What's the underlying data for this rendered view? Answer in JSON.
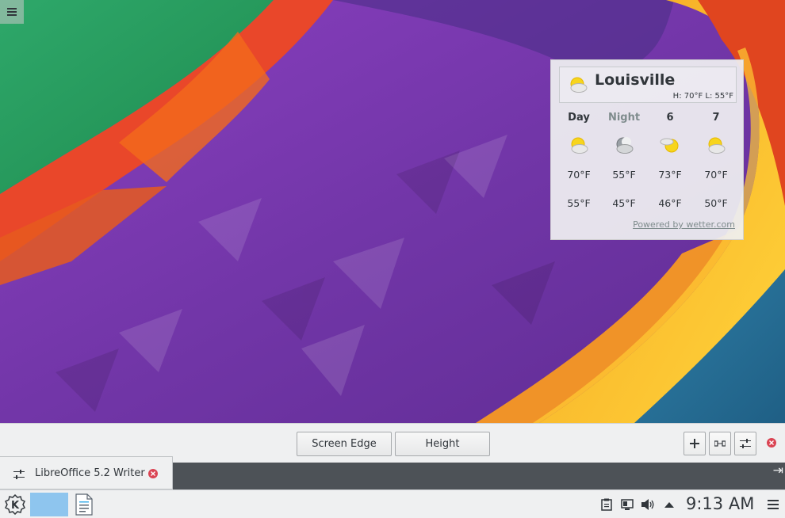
{
  "weather": {
    "city": "Louisville",
    "hilo": "H: 70°F L: 55°F",
    "current_icon": "partly-cloudy-day-icon",
    "forecast": [
      {
        "label": "Day",
        "icon": "partly-cloudy-day-icon",
        "high": "70°F",
        "low": "55°F"
      },
      {
        "label": "Night",
        "icon": "partly-cloudy-night-icon",
        "high": "55°F",
        "low": "45°F"
      },
      {
        "label": "6",
        "icon": "partly-sunny-icon",
        "high": "73°F",
        "low": "46°F"
      },
      {
        "label": "7",
        "icon": "partly-cloudy-day-icon",
        "high": "70°F",
        "low": "50°F"
      }
    ],
    "powered_by": "Powered by wetter.com"
  },
  "panel_toolbar": {
    "screen_edge_label": "Screen Edge",
    "height_label": "Height"
  },
  "task_popup": {
    "label": "LibreOffice 5.2 Writer"
  },
  "taskbar": {
    "clock": "9:13 AM"
  },
  "colors": {
    "accent": "#3daee9",
    "close": "#da4453",
    "pager": "#8ec5ee"
  }
}
